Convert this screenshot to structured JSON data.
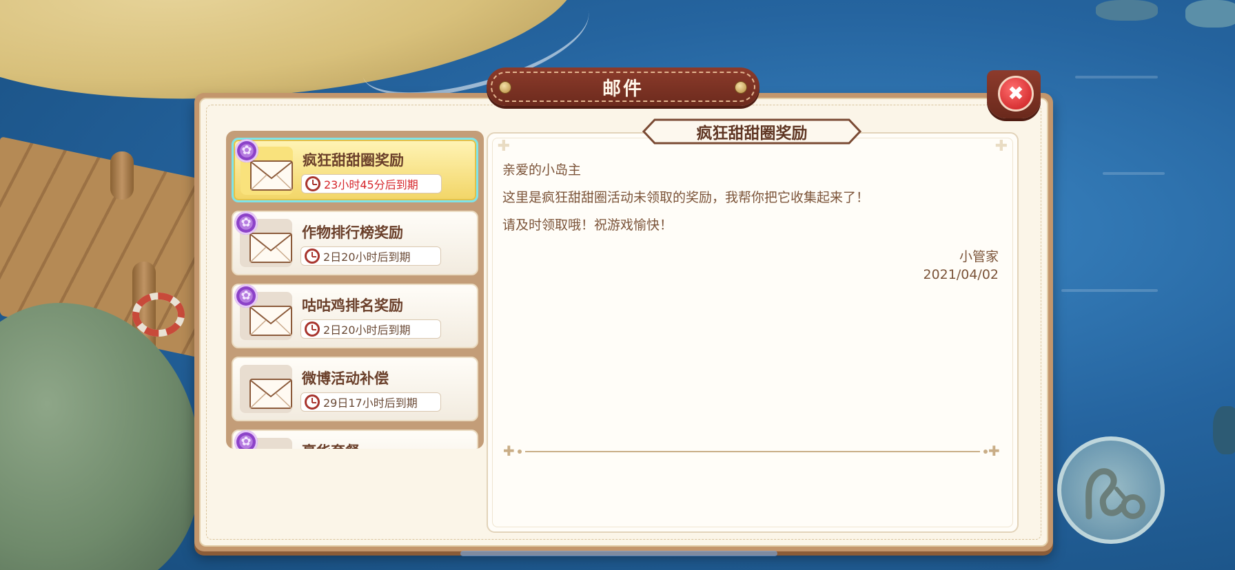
{
  "window": {
    "title": "邮件"
  },
  "close_button": {
    "label": "✖",
    "icon": "close-icon"
  },
  "mail_list": [
    {
      "title": "疯狂甜甜圈奖励",
      "expire": "23小时45分后到期",
      "selected": true,
      "has_attachment": true
    },
    {
      "title": "作物排行榜奖励",
      "expire": "2日20小时后到期",
      "selected": false,
      "has_attachment": true
    },
    {
      "title": "咕咕鸡排名奖励",
      "expire": "2日20小时后到期",
      "selected": false,
      "has_attachment": true
    },
    {
      "title": "微博活动补偿",
      "expire": "29日17小时后到期",
      "selected": false,
      "has_attachment": false
    },
    {
      "title": "豪华套餐",
      "expire": "",
      "selected": false,
      "has_attachment": true
    }
  ],
  "detail": {
    "title": "疯狂甜甜圈奖励",
    "greeting": "亲爱的小岛主",
    "line1": "这里是疯狂甜甜圈活动未领取的奖励，我帮你把它收集起来了！",
    "line2": "请及时领取哦！祝游戏愉快！",
    "sender": "小管家",
    "date": "2021/04/02"
  },
  "colors": {
    "accent_red": "#d6262b",
    "banner_brown": "#8c3b2b",
    "selected_yellow": "#f2d566",
    "gear_purple": "#8c42c8"
  }
}
